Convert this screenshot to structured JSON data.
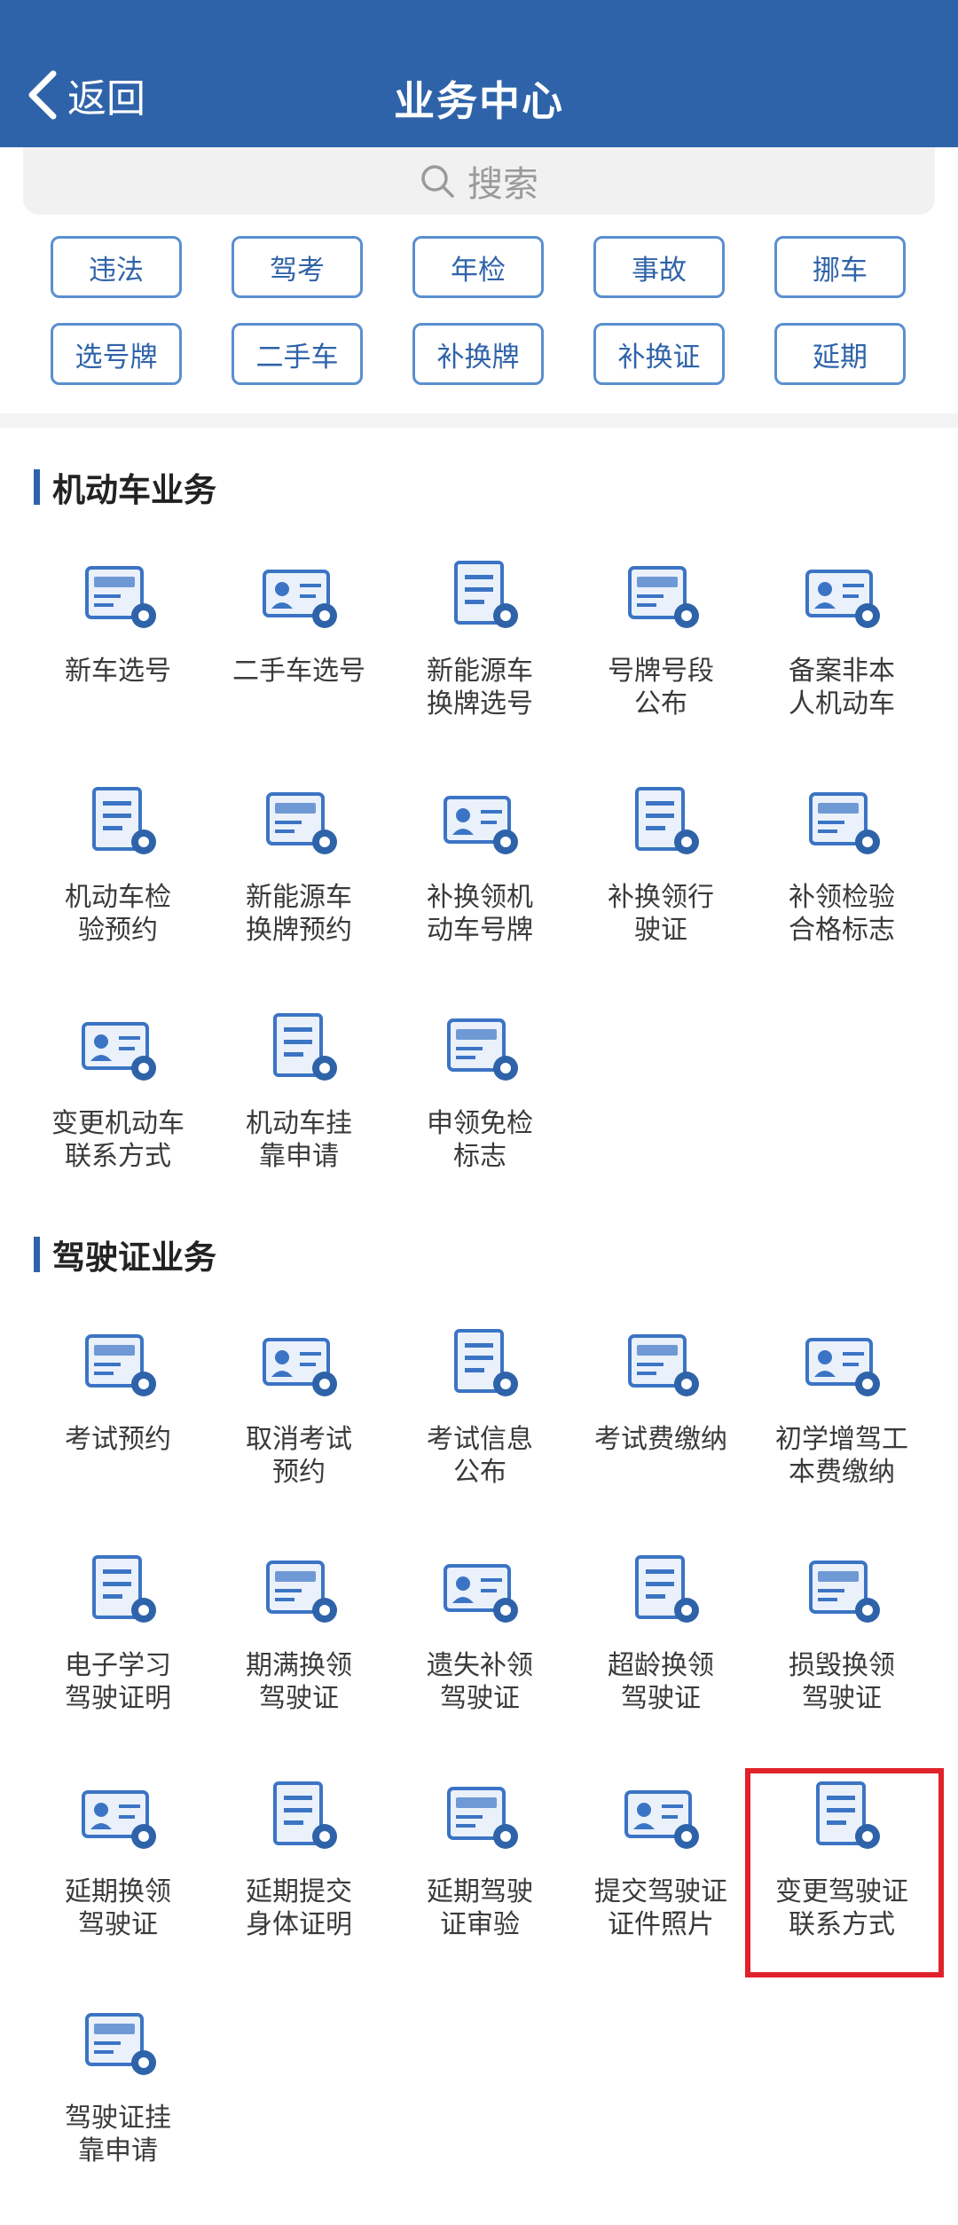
{
  "header": {
    "back_label": "返回",
    "title": "业务中心"
  },
  "search": {
    "placeholder": "搜索"
  },
  "quick_tags": [
    "违法",
    "驾考",
    "年检",
    "事故",
    "挪车",
    "选号牌",
    "二手车",
    "补换牌",
    "补换证",
    "延期"
  ],
  "sections": [
    {
      "title": "机动车业务",
      "items": [
        [
          "新车选号",
          "plate-select-icon"
        ],
        [
          "二手车选号",
          "used-car-icon"
        ],
        [
          "新能源车\n换牌选号",
          "ev-swap-icon"
        ],
        [
          "号牌号段\n公布",
          "plate-announce-icon"
        ],
        [
          "备案非本\n人机动车",
          "filing-icon"
        ],
        [
          "机动车检\n验预约",
          "inspection-booking-icon"
        ],
        [
          "新能源车\n换牌预约",
          "ev-plate-booking-icon"
        ],
        [
          "补换领机\n动车号牌",
          "plate-replace-icon"
        ],
        [
          "补换领行\n驶证",
          "license-replace-icon"
        ],
        [
          "补领检验\n合格标志",
          "inspection-mark-icon"
        ],
        [
          "变更机动车\n联系方式",
          "vehicle-contact-icon"
        ],
        [
          "机动车挂\n靠申请",
          "vehicle-affiliation-icon"
        ],
        [
          "申领免检\n标志",
          "exempt-mark-icon"
        ]
      ]
    },
    {
      "title": "驾驶证业务",
      "items": [
        [
          "考试预约",
          "exam-booking-icon"
        ],
        [
          "取消考试\n预约",
          "cancel-exam-icon"
        ],
        [
          "考试信息\n公布",
          "exam-info-icon"
        ],
        [
          "考试费缴纳",
          "exam-fee-icon"
        ],
        [
          "初学增驾工\n本费缴纳",
          "cost-fee-icon"
        ],
        [
          "电子学习\n驾驶证明",
          "e-learning-icon"
        ],
        [
          "期满换领\n驾驶证",
          "expiry-renew-icon"
        ],
        [
          "遗失补领\n驾驶证",
          "lost-replace-icon"
        ],
        [
          "超龄换领\n驾驶证",
          "overage-renew-icon"
        ],
        [
          "损毁换领\n驾驶证",
          "damaged-renew-icon"
        ],
        [
          "延期换领\n驾驶证",
          "deferred-renew-icon"
        ],
        [
          "延期提交\n身体证明",
          "deferred-health-icon"
        ],
        [
          "延期驾驶\n证审验",
          "deferred-review-icon"
        ],
        [
          "提交驾驶证\n证件照片",
          "photo-upload-icon"
        ],
        [
          "变更驾驶证\n联系方式",
          "license-contact-icon"
        ],
        [
          "驾驶证挂\n靠申请",
          "license-affiliation-icon"
        ]
      ]
    }
  ]
}
